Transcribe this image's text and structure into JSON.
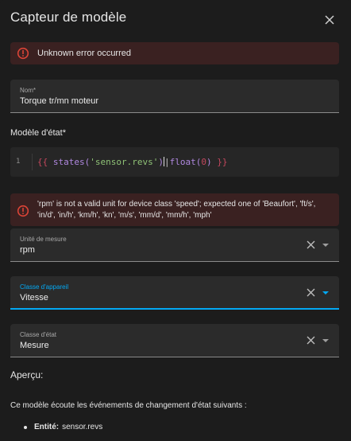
{
  "dialog": {
    "title": "Capteur de modèle"
  },
  "errors": {
    "top": "Unknown error occurred",
    "unit": "'rpm' is not a valid unit for device class 'speed'; expected one of 'Beaufort', 'ft/s', 'in/d', 'in/h', 'km/h', 'kn', 'm/s', 'mm/d', 'mm/h', 'mph'"
  },
  "name_field": {
    "label": "Nom*",
    "value": "Torque tr/mn moteur"
  },
  "state_template": {
    "label": "Modèle d'état*",
    "line_number": "1",
    "tokens": {
      "open": "{{ ",
      "fn": "states(",
      "str": "'sensor.revs'",
      "close_paren": ")",
      "pipe": "|",
      "filter": "float(",
      "num": "0",
      "filter_close": ")",
      "end": " }}"
    }
  },
  "unit_field": {
    "label": "Unité de mesure",
    "value": "rpm"
  },
  "device_class_field": {
    "label": "Classe d'appareil",
    "value": "Vitesse"
  },
  "state_class_field": {
    "label": "Classe d'état",
    "value": "Mesure"
  },
  "preview": {
    "heading": "Aperçu:",
    "listen_text": "Ce modèle écoute les événements de changement d'état suivants :",
    "entity_label": "Entité:",
    "entity_value": "sensor.revs"
  },
  "colors": {
    "accent": "#03a9f4",
    "error_bg": "#3a2121",
    "error_icon": "#db4437"
  },
  "icons": [
    "close-icon",
    "alert-circle-icon",
    "clear-icon",
    "dropdown-caret-icon"
  ]
}
